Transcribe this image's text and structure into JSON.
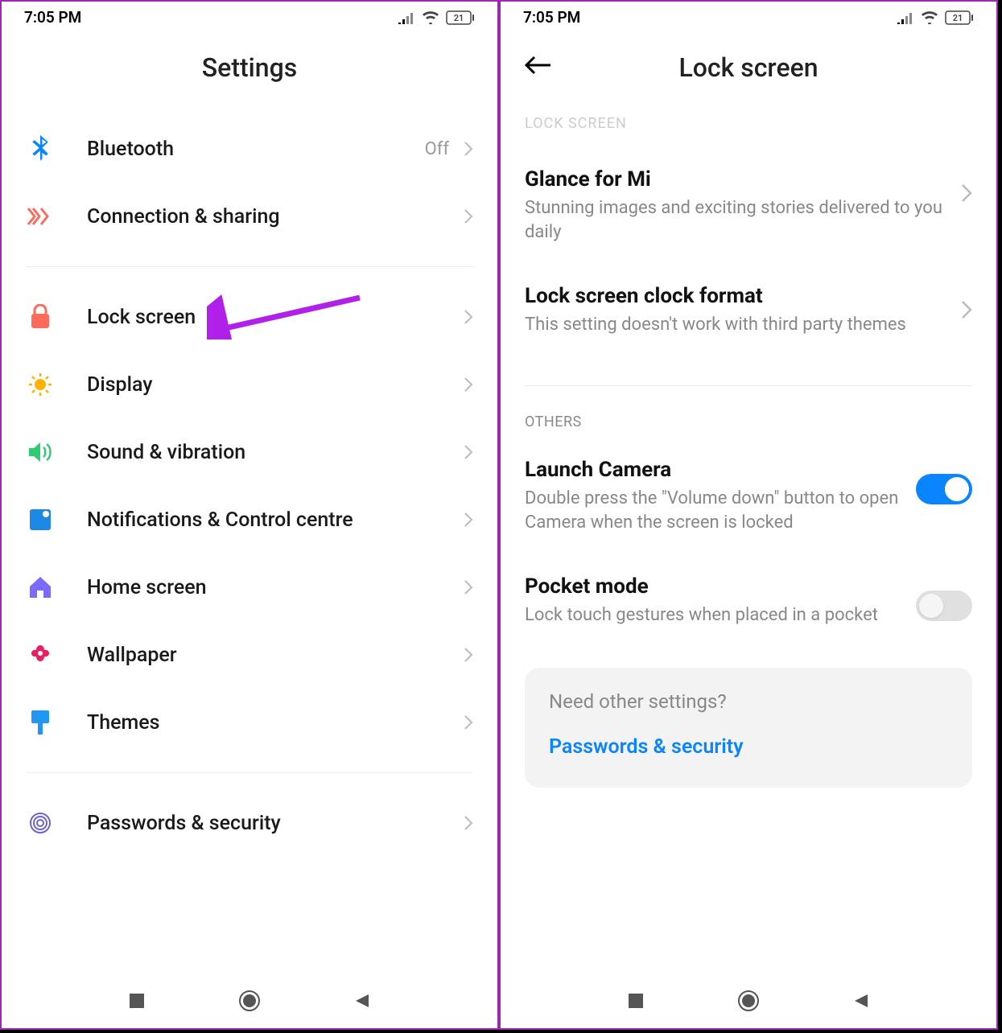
{
  "status": {
    "time": "7:05 PM",
    "battery": "21"
  },
  "left": {
    "title": "Settings",
    "items": [
      {
        "id": "bluetooth",
        "label": "Bluetooth",
        "value": "Off",
        "icon": "bluetooth",
        "color": "#0a84ff"
      },
      {
        "id": "connection",
        "label": "Connection & sharing",
        "icon": "connection",
        "color": "#ff6b5b"
      },
      {
        "id": "lock-screen",
        "label": "Lock screen",
        "icon": "lock",
        "color": "#ff6b5b"
      },
      {
        "id": "display",
        "label": "Display",
        "icon": "sun",
        "color": "#ffb300"
      },
      {
        "id": "sound",
        "label": "Sound & vibration",
        "icon": "volume",
        "color": "#2ecc71"
      },
      {
        "id": "notifications",
        "label": "Notifications & Control centre",
        "icon": "tile",
        "color": "#1e88e5"
      },
      {
        "id": "home",
        "label": "Home screen",
        "icon": "home",
        "color": "#7c6aff"
      },
      {
        "id": "wallpaper",
        "label": "Wallpaper",
        "icon": "flower",
        "color": "#e91e63"
      },
      {
        "id": "themes",
        "label": "Themes",
        "icon": "brush",
        "color": "#2196f3"
      },
      {
        "id": "passwords",
        "label": "Passwords & security",
        "icon": "fingerprint",
        "color": "#6a63d8"
      }
    ]
  },
  "right": {
    "title": "Lock screen",
    "cutHeader": "LOCK SCREEN",
    "sectionOthers": "OTHERS",
    "glance": {
      "title": "Glance for Mi",
      "desc": "Stunning images and exciting stories delivered to you daily"
    },
    "clock": {
      "title": "Lock screen clock format",
      "desc": "This setting doesn't work with third party themes"
    },
    "camera": {
      "title": "Launch Camera",
      "desc": "Double press the \"Volume down\" button to open Camera when the screen is locked",
      "enabled": true
    },
    "pocket": {
      "title": "Pocket mode",
      "desc": "Lock touch gestures when placed in a pocket",
      "enabled": false
    },
    "otherCard": {
      "prompt": "Need other settings?",
      "link": "Passwords & security"
    }
  }
}
